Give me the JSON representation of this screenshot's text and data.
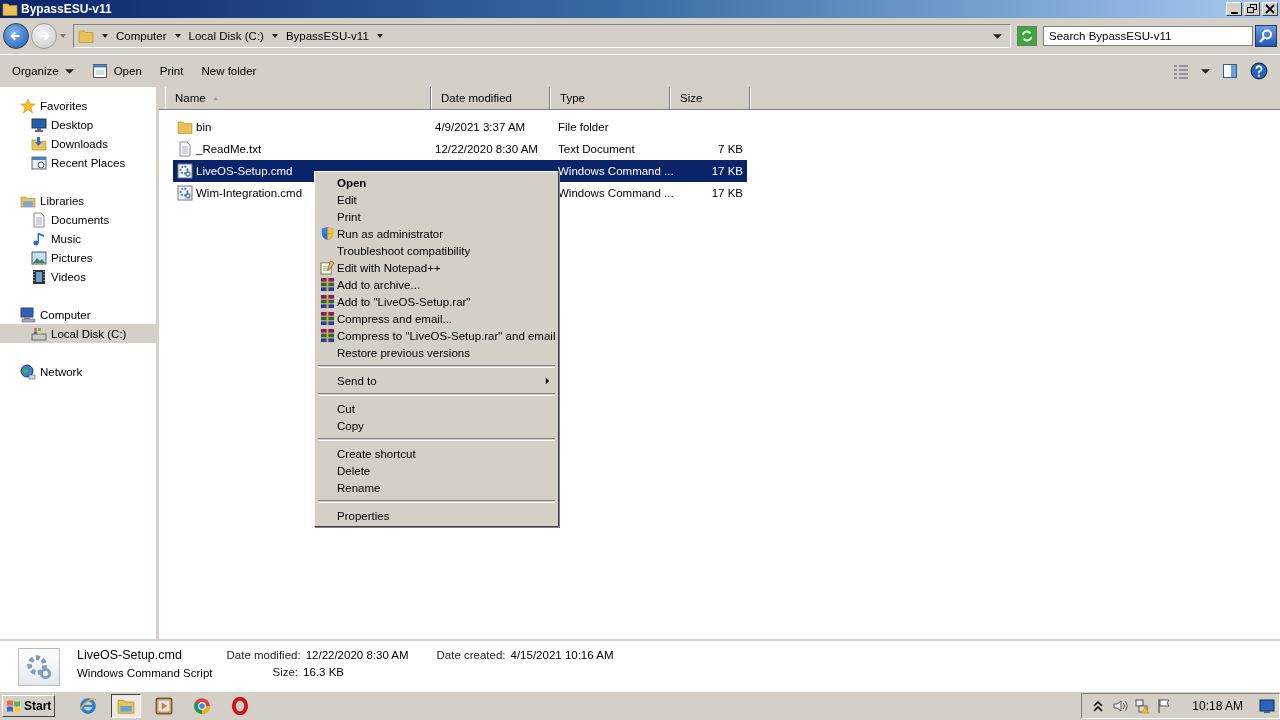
{
  "window": {
    "title": "BypassESU-v11"
  },
  "nav": {
    "back": {
      "disabled": false
    },
    "forward": {
      "disabled": true
    }
  },
  "address_bar": {
    "crumbs": [
      "Computer",
      "Local Disk (C:)",
      "BypassESU-v11"
    ]
  },
  "search": {
    "placeholder": "Search BypassESU-v11"
  },
  "toolbar": {
    "buttons": [
      {
        "label": "Organize",
        "kind": "menu"
      },
      {
        "label": "Open",
        "kind": "icon"
      },
      {
        "label": "Print",
        "kind": "plain"
      },
      {
        "label": "New folder",
        "kind": "plain"
      }
    ]
  },
  "sidebar": {
    "groups": [
      {
        "label": "Favorites",
        "selected": false,
        "children": [
          {
            "label": "Desktop",
            "selected": false
          },
          {
            "label": "Downloads",
            "selected": false
          },
          {
            "label": "Recent Places",
            "selected": false
          }
        ]
      },
      {
        "label": "Libraries",
        "selected": false,
        "children": [
          {
            "label": "Documents",
            "selected": false
          },
          {
            "label": "Music",
            "selected": false
          },
          {
            "label": "Pictures",
            "selected": false
          },
          {
            "label": "Videos",
            "selected": false
          }
        ]
      },
      {
        "label": "Computer",
        "selected": false,
        "children": [
          {
            "label": "Local Disk (C:)",
            "selected": true
          }
        ]
      },
      {
        "label": "Network",
        "selected": false
      }
    ]
  },
  "table": {
    "columns": [
      {
        "label": "Name",
        "sorted": true
      },
      {
        "label": "Date modified",
        "sorted": false
      },
      {
        "label": "Type",
        "sorted": false
      },
      {
        "label": "Size",
        "sorted": false
      }
    ],
    "rows": [
      {
        "name": "bin",
        "kind": "folder",
        "date": "4/9/2021 3:37 AM",
        "type": "File folder",
        "selected": false
      },
      {
        "name": "_ReadMe.txt",
        "kind": "text",
        "date": "12/22/2020 8:30 AM",
        "type": "Text Document",
        "size": "7 KB",
        "selected": false
      },
      {
        "name": "LiveOS-Setup.cmd",
        "kind": "script",
        "type": "Windows Command ...",
        "size": "17 KB",
        "selected": true
      },
      {
        "name": "Wim-Integration.cmd",
        "kind": "script",
        "type": "Windows Command ...",
        "size": "17 KB",
        "selected": false
      }
    ]
  },
  "context_menu": {
    "items": [
      {
        "kind": "item",
        "label": "Open",
        "default": true,
        "submenu": false
      },
      {
        "kind": "item",
        "label": "Edit",
        "default": false,
        "submenu": false
      },
      {
        "kind": "item",
        "label": "Print",
        "default": false,
        "submenu": false
      },
      {
        "kind": "item",
        "label": "Run as administrator",
        "default": false,
        "submenu": false
      },
      {
        "kind": "item",
        "label": "Troubleshoot compatibility",
        "default": false,
        "submenu": false
      },
      {
        "kind": "item",
        "label": "Edit with Notepad++",
        "default": false,
        "submenu": false
      },
      {
        "kind": "item",
        "label": "Add to archive...",
        "default": false,
        "submenu": false
      },
      {
        "kind": "item",
        "label": "Add to \"LiveOS-Setup.rar\"",
        "default": false,
        "submenu": false
      },
      {
        "kind": "item",
        "label": "Compress and email...",
        "default": false,
        "submenu": false
      },
      {
        "kind": "item",
        "label": "Compress to \"LiveOS-Setup.rar\" and email",
        "default": false,
        "submenu": false
      },
      {
        "kind": "item",
        "label": "Restore previous versions",
        "default": false,
        "submenu": false
      },
      {
        "kind": "separator"
      },
      {
        "kind": "item",
        "label": "Send to",
        "default": false,
        "submenu": true
      },
      {
        "kind": "separator"
      },
      {
        "kind": "item",
        "label": "Cut",
        "default": false,
        "submenu": false
      },
      {
        "kind": "item",
        "label": "Copy",
        "default": false,
        "submenu": false
      },
      {
        "kind": "separator"
      },
      {
        "kind": "item",
        "label": "Create shortcut",
        "default": false,
        "submenu": false
      },
      {
        "kind": "item",
        "label": "Delete",
        "default": false,
        "submenu": false
      },
      {
        "kind": "item",
        "label": "Rename",
        "default": false,
        "submenu": false
      },
      {
        "kind": "separator"
      },
      {
        "kind": "item",
        "label": "Properties",
        "default": false,
        "submenu": false
      }
    ]
  },
  "details": {
    "name": "LiveOS-Setup.cmd",
    "type": "Windows Command Script",
    "fields": [
      {
        "label": "Date modified:",
        "value": "12/22/2020 8:30 AM"
      },
      {
        "label": "Size:",
        "value": "16.3 KB"
      },
      {
        "label": "Date created:",
        "value": "4/15/2021 10:16 AM"
      }
    ]
  },
  "taskbar": {
    "start": "Start",
    "apps": [
      {
        "kind": "ie",
        "selected": false
      },
      {
        "kind": "explorer",
        "selected": true
      },
      {
        "kind": "media",
        "selected": false
      },
      {
        "kind": "chrome",
        "selected": false
      },
      {
        "kind": "opera",
        "selected": false
      }
    ],
    "clock": "10:18 AM"
  }
}
